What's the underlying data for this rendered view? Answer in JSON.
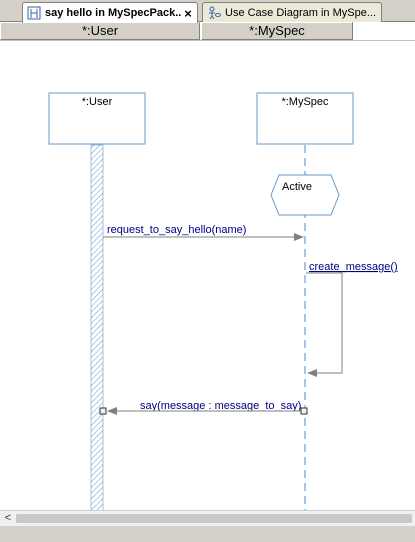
{
  "tabs": [
    {
      "label": "say hello in MySpecPack...",
      "close": "×",
      "icon": "sequence-diagram-icon",
      "active": true
    },
    {
      "label": "Use Case Diagram in MySpe...",
      "icon": "use-case-diagram-icon",
      "active": false
    }
  ],
  "lifeline_headers": [
    "*:User",
    "*:MySpec"
  ],
  "diagram": {
    "lifelines": [
      {
        "name": "*:User"
      },
      {
        "name": "*:MySpec"
      }
    ],
    "state_label": "Active",
    "messages": [
      {
        "label": "request_to_say_hello(name)",
        "from": "*:User",
        "to": "*:MySpec"
      },
      {
        "label": "create_message()",
        "from": "*:MySpec",
        "to": "*:MySpec"
      },
      {
        "label": "say(message : message_to_say)",
        "from": "*:MySpec",
        "to": "*:User"
      }
    ]
  },
  "scrollbar": {
    "left_arrow": "<"
  },
  "colors": {
    "lifeline_box": "#6699cc",
    "lifeline_dash": "#4a8ad0",
    "message_text": "#000080",
    "arrow": "#808080",
    "hatch": "#6699cc"
  }
}
